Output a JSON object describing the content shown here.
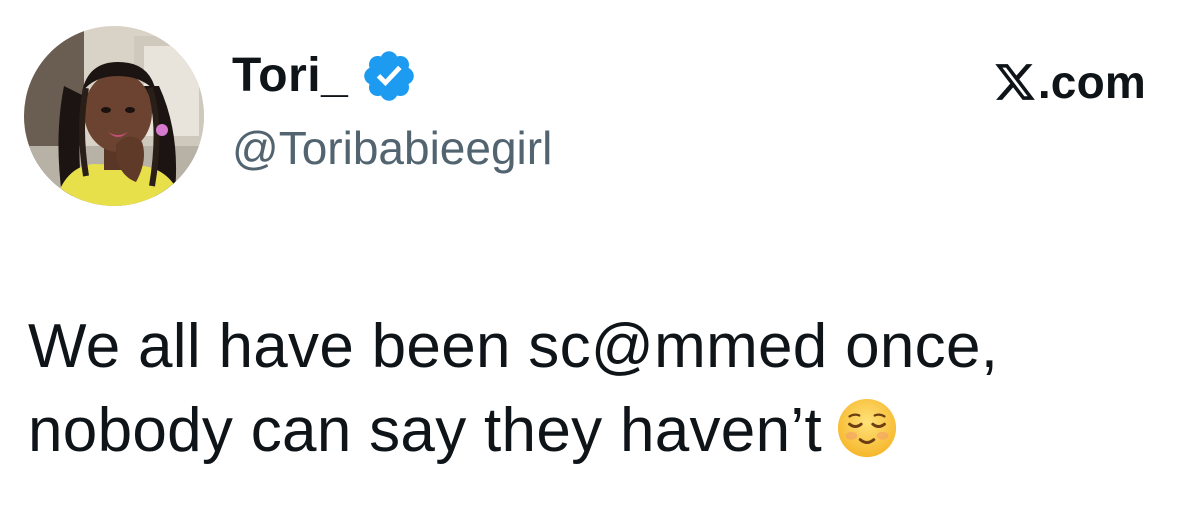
{
  "tweet": {
    "author": {
      "display_name": "Tori_",
      "handle": "@Toribabieegirl",
      "verified_icon": "verified-badge-icon",
      "avatar_icon": "profile-avatar"
    },
    "source": {
      "brand_text": ".com",
      "brand_icon": "x-logo-icon"
    },
    "text_lines": [
      "We all have been sc@mmed once,",
      "nobody can say they haven’t"
    ],
    "emoji_icon": "relieved-face-emoji-icon"
  },
  "colors": {
    "text_primary": "#0f1419",
    "text_secondary": "#536471",
    "verified_blue": "#1d9bf0",
    "background": "#ffffff"
  }
}
